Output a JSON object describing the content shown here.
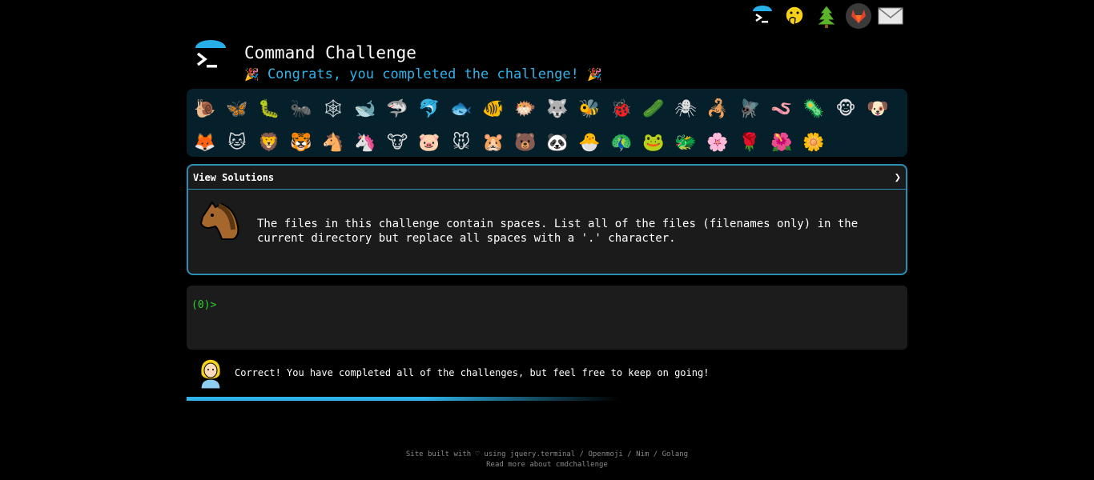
{
  "top_nav": [
    {
      "name": "terminal-icon",
      "glyph": ">_"
    },
    {
      "name": "face-hand-over-mouth-icon",
      "glyph": "🤭"
    },
    {
      "name": "tree-icon",
      "glyph": "🌲"
    },
    {
      "name": "gitlab-icon",
      "glyph": "🦊"
    },
    {
      "name": "mail-icon",
      "glyph": "✉"
    }
  ],
  "header": {
    "title": "Command Challenge",
    "subtitle": "Congrats, you completed the challenge!",
    "party_icon": "🎉"
  },
  "challenges": [
    {
      "name": "snail",
      "glyph": "🐌"
    },
    {
      "name": "butterfly",
      "glyph": "🦋"
    },
    {
      "name": "caterpillar",
      "glyph": "🐛"
    },
    {
      "name": "ant",
      "glyph": "🐜"
    },
    {
      "name": "spider-web",
      "glyph": "🕸"
    },
    {
      "name": "whale",
      "glyph": "🐋"
    },
    {
      "name": "shark",
      "glyph": "🦈"
    },
    {
      "name": "dolphin",
      "glyph": "🐬"
    },
    {
      "name": "fish",
      "glyph": "🐟"
    },
    {
      "name": "tropical-fish",
      "glyph": "🐠"
    },
    {
      "name": "blowfish",
      "glyph": "🐡"
    },
    {
      "name": "wolf",
      "glyph": "🐺"
    },
    {
      "name": "bee",
      "glyph": "🐝"
    },
    {
      "name": "ladybug",
      "glyph": "🐞"
    },
    {
      "name": "cucumber",
      "glyph": "🥒"
    },
    {
      "name": "spider",
      "glyph": "🕷"
    },
    {
      "name": "scorpion",
      "glyph": "🦂"
    },
    {
      "name": "fly",
      "glyph": "🪰"
    },
    {
      "name": "worm",
      "glyph": "🪱"
    },
    {
      "name": "microbe",
      "glyph": "🦠"
    },
    {
      "name": "monkey",
      "glyph": "🐵"
    },
    {
      "name": "dog",
      "glyph": "🐶"
    },
    {
      "name": "fox",
      "glyph": "🦊"
    },
    {
      "name": "cat",
      "glyph": "🐱"
    },
    {
      "name": "lion",
      "glyph": "🦁"
    },
    {
      "name": "tiger",
      "glyph": "🐯"
    },
    {
      "name": "horse",
      "glyph": "🐴"
    },
    {
      "name": "unicorn",
      "glyph": "🦄"
    },
    {
      "name": "cow",
      "glyph": "🐮"
    },
    {
      "name": "pig",
      "glyph": "🐷"
    },
    {
      "name": "mouse",
      "glyph": "🐭"
    },
    {
      "name": "hamster",
      "glyph": "🐹"
    },
    {
      "name": "bear",
      "glyph": "🐻"
    },
    {
      "name": "panda",
      "glyph": "🐼"
    },
    {
      "name": "hatching-chick",
      "glyph": "🐣"
    },
    {
      "name": "peacock",
      "glyph": "🦚"
    },
    {
      "name": "frog",
      "glyph": "🐸"
    },
    {
      "name": "dragon",
      "glyph": "🐲"
    },
    {
      "name": "blossom",
      "glyph": "🌸"
    },
    {
      "name": "rose",
      "glyph": "🌹"
    },
    {
      "name": "hibiscus",
      "glyph": "🌺"
    },
    {
      "name": "sunflower",
      "glyph": "🌼"
    }
  ],
  "solutions": {
    "label": "View Solutions",
    "chevron": "❯",
    "description": "The files in this challenge contain spaces. List all of the files (filenames only) in the current directory but replace all spaces with a '.' character."
  },
  "terminal": {
    "prompt": "(0)>"
  },
  "result": {
    "message": "Correct! You have completed all of the challenges, but feel free to keep on going!",
    "progress": 1.0
  },
  "footer": {
    "line1": "Site built with ♡ using jquery.terminal / Openmoji / Nim / Golang",
    "line2": "Read more about cmdchallenge"
  },
  "colors": {
    "accent": "#2fb3e8",
    "prompt": "#2bd12b",
    "panel_border": "#2a8fb3",
    "grid_bg": "#06202b"
  }
}
